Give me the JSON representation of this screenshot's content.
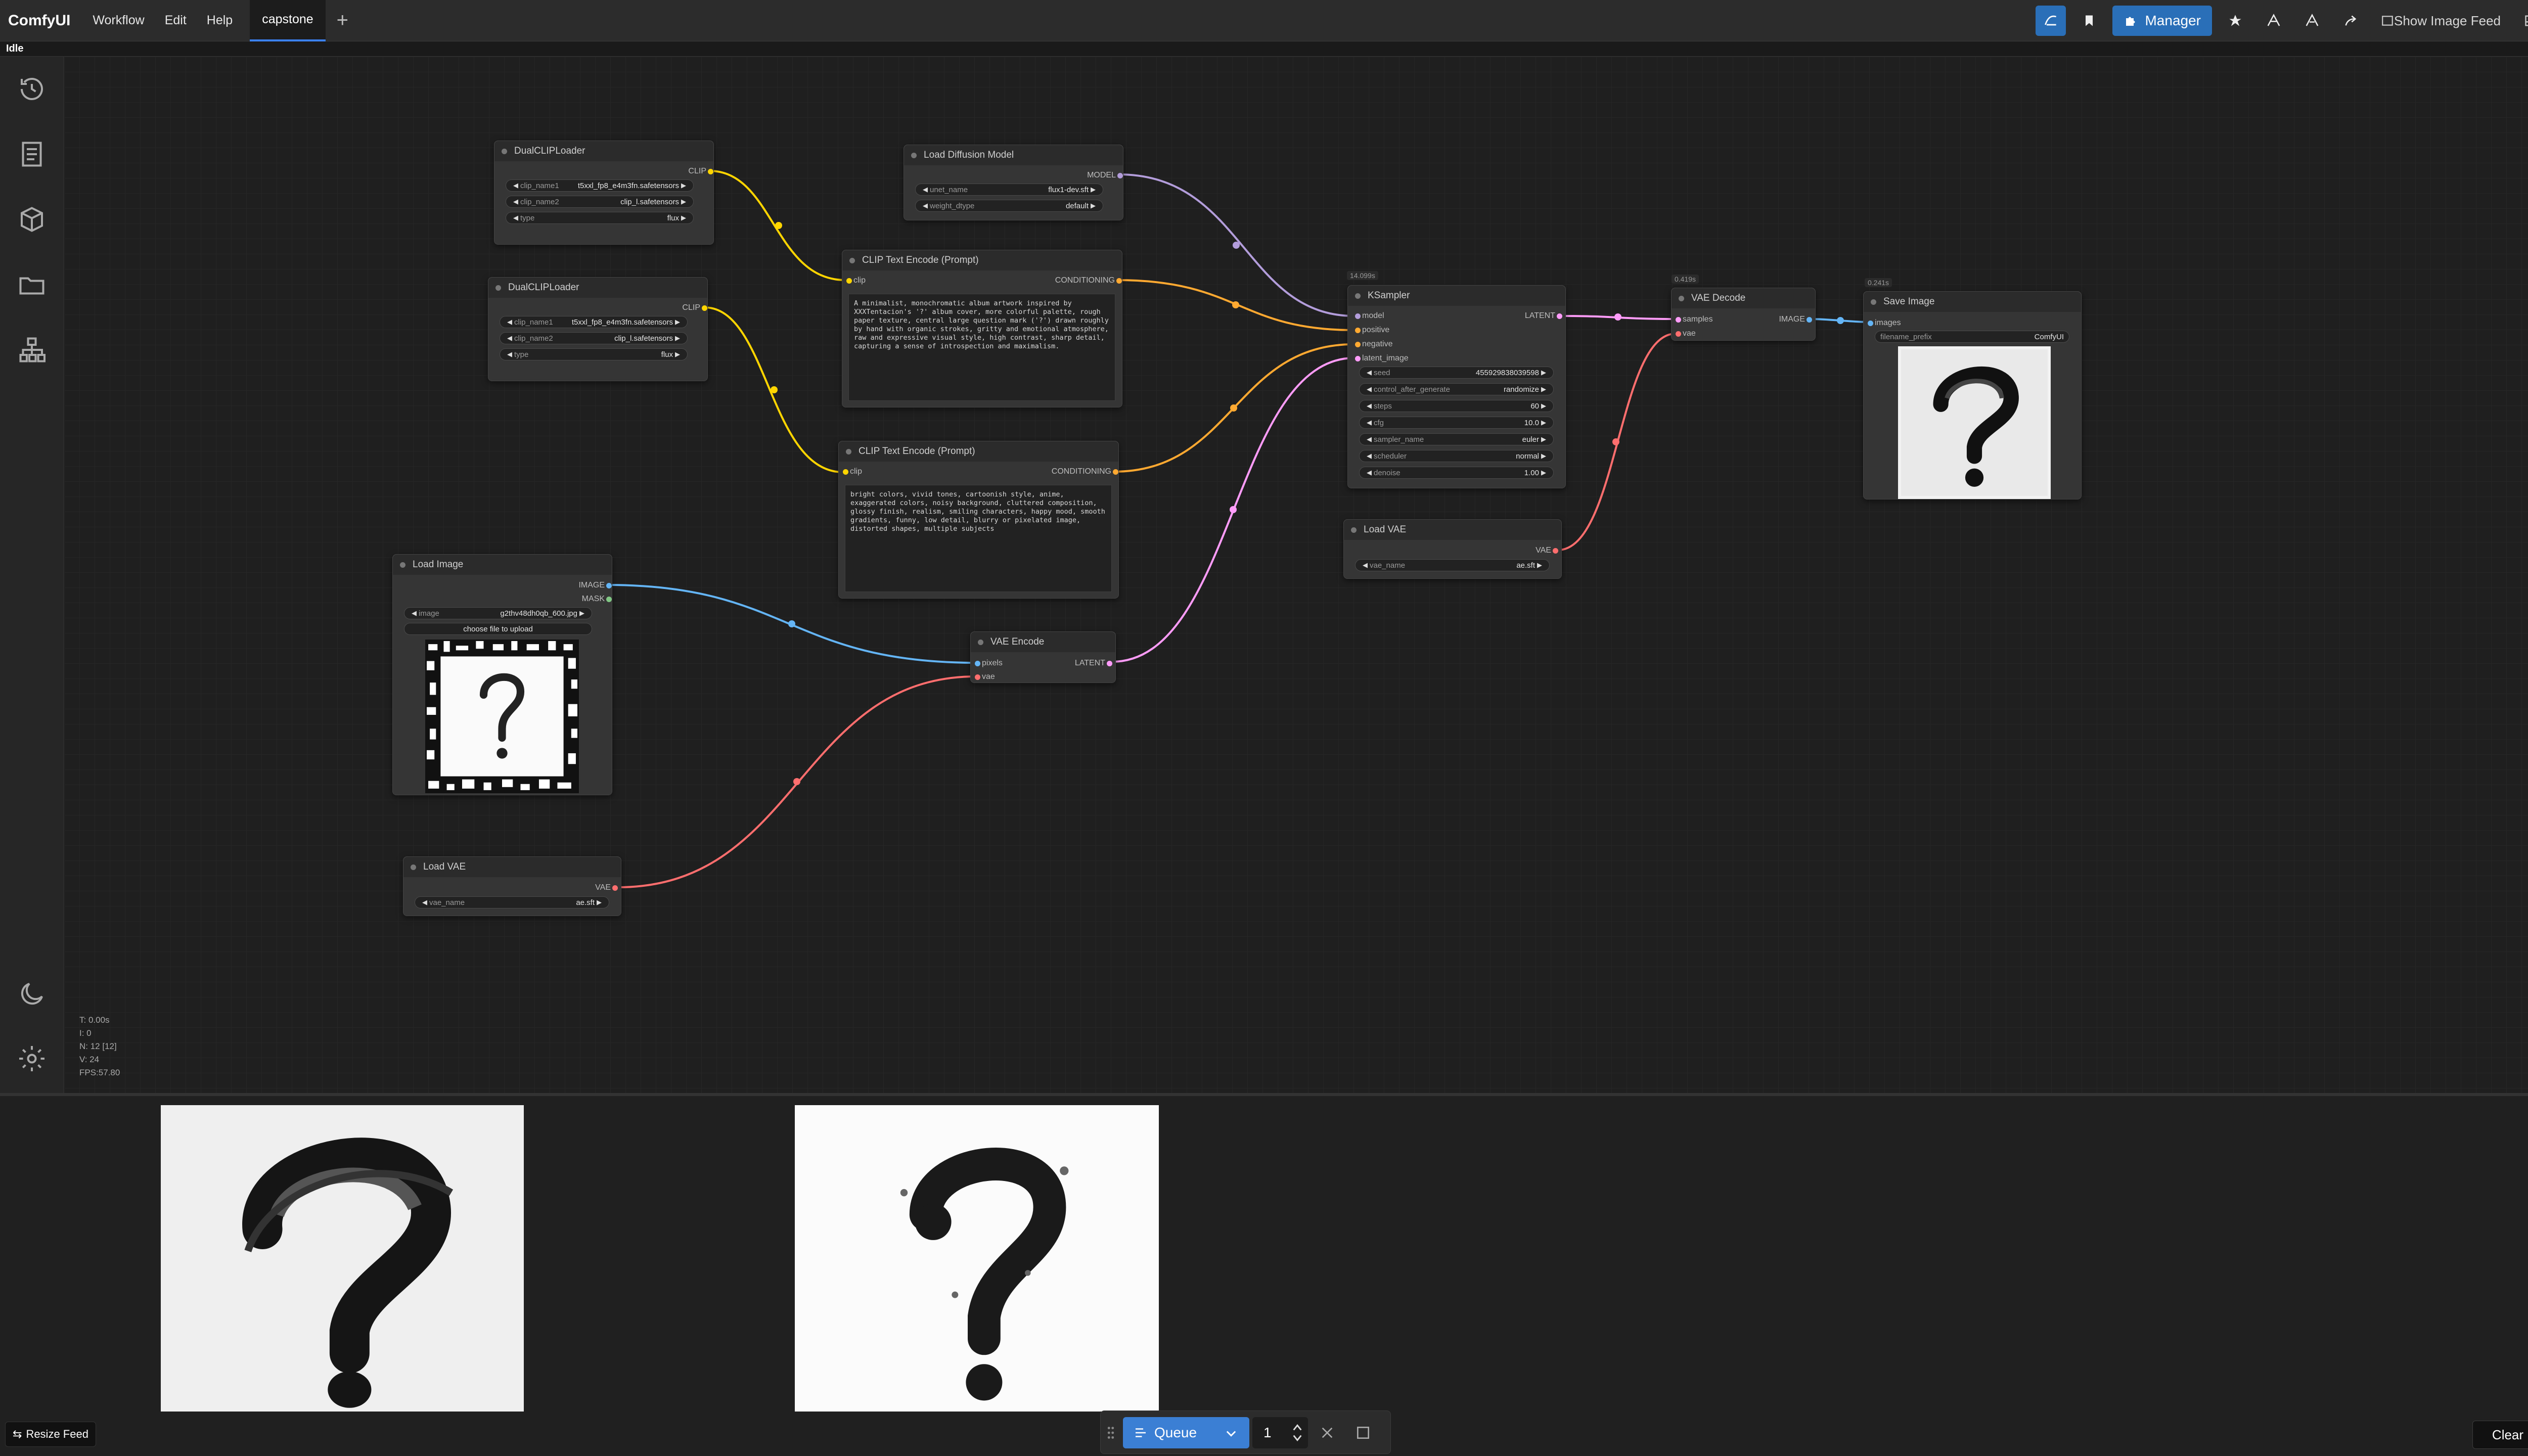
{
  "app": {
    "title": "ComfyUI",
    "status": "Idle"
  },
  "menu": {
    "items": [
      "Workflow",
      "Edit",
      "Help"
    ]
  },
  "tabs": {
    "active": "capstone",
    "add_label": "+"
  },
  "toolbar": {
    "manager_label": "Manager",
    "show_image_feed": "Show Image Feed"
  },
  "stats": {
    "t": "T: 0.00s",
    "i": "I: 0",
    "n": "N: 12 [12]",
    "v": "V: 24",
    "fps": "FPS:57.80"
  },
  "nodes": {
    "dualclip1": {
      "title": "DualCLIPLoader",
      "out": "CLIP",
      "w1_label": "clip_name1",
      "w1_value": "t5xxl_fp8_e4m3fn.safetensors",
      "w2_label": "clip_name2",
      "w2_value": "clip_l.safetensors",
      "w3_label": "type",
      "w3_value": "flux"
    },
    "dualclip2": {
      "title": "DualCLIPLoader",
      "out": "CLIP",
      "w1_label": "clip_name1",
      "w1_value": "t5xxl_fp8_e4m3fn.safetensors",
      "w2_label": "clip_name2",
      "w2_value": "clip_l.safetensors",
      "w3_label": "type",
      "w3_value": "flux"
    },
    "diffusion": {
      "title": "Load Diffusion Model",
      "out": "MODEL",
      "w1_label": "unet_name",
      "w1_value": "flux1-dev.sft",
      "w2_label": "weight_dtype",
      "w2_value": "default"
    },
    "clip_pos": {
      "title": "CLIP Text Encode (Prompt)",
      "in": "clip",
      "out": "CONDITIONING",
      "text": "A minimalist, monochromatic album artwork inspired by XXXTentacion's '?' album cover, more colorful palette, rough paper texture, central large question mark ('?') drawn roughly by hand with organic strokes, gritty and emotional atmosphere, raw and expressive visual style, high contrast, sharp detail, capturing a sense of introspection and maximalism."
    },
    "clip_neg": {
      "title": "CLIP Text Encode (Prompt)",
      "in": "clip",
      "out": "CONDITIONING",
      "text": "bright colors, vivid tones, cartoonish style, anime, exaggerated colors, noisy background, cluttered composition, glossy finish, realism, smiling characters, happy mood, smooth gradients, funny, low detail, blurry or pixelated image, distorted shapes, multiple subjects"
    },
    "ksampler": {
      "title": "KSampler",
      "badge": "14.099s",
      "in_model": "model",
      "in_positive": "positive",
      "in_negative": "negative",
      "in_latent": "latent_image",
      "out": "LATENT",
      "widgets": [
        {
          "label": "seed",
          "value": "455929838039598"
        },
        {
          "label": "control_after_generate",
          "value": "randomize"
        },
        {
          "label": "steps",
          "value": "60"
        },
        {
          "label": "cfg",
          "value": "10.0"
        },
        {
          "label": "sampler_name",
          "value": "euler"
        },
        {
          "label": "scheduler",
          "value": "normal"
        },
        {
          "label": "denoise",
          "value": "1.00"
        }
      ]
    },
    "vae_decode": {
      "title": "VAE Decode",
      "badge": "0.419s",
      "in_samples": "samples",
      "in_vae": "vae",
      "out": "IMAGE"
    },
    "save_image": {
      "title": "Save Image",
      "badge": "0.241s",
      "in": "images",
      "w_label": "filename_prefix",
      "w_value": "ComfyUI"
    },
    "load_vae1": {
      "title": "Load VAE",
      "out": "VAE",
      "w_label": "vae_name",
      "w_value": "ae.sft"
    },
    "load_image": {
      "title": "Load Image",
      "out_image": "IMAGE",
      "out_mask": "MASK",
      "w_label": "image",
      "w_value": "g2thv48dh0qb_600.jpg",
      "upload": "choose file to upload"
    },
    "vae_encode": {
      "title": "VAE Encode",
      "in_pixels": "pixels",
      "in_vae": "vae",
      "out": "LATENT"
    },
    "load_vae2": {
      "title": "Load VAE",
      "out": "VAE",
      "w_label": "vae_name",
      "w_value": "ae.sft"
    }
  },
  "queue": {
    "label": "Queue",
    "count": "1"
  },
  "feed": {
    "resize_label": "Resize Feed",
    "clear_label": "Clear"
  },
  "colors": {
    "clip": "#ffd500",
    "model": "#b39ddb",
    "conditioning": "#ffa931",
    "latent": "#ff9cf9",
    "image": "#64b5f6",
    "vae": "#ff6e6e",
    "accent": "#3b82f6"
  },
  "icons": [
    "history-icon",
    "queue-list-icon",
    "model-cube-icon",
    "folder-icon",
    "node-tree-icon",
    "moon-icon",
    "gear-icon",
    "manager-puzzle-icon",
    "star-icon",
    "share-icon",
    "bookmark-icon",
    "zoom-in-icon",
    "zoom-out-icon",
    "fit-view-icon",
    "pointer-icon",
    "eye-icon"
  ]
}
